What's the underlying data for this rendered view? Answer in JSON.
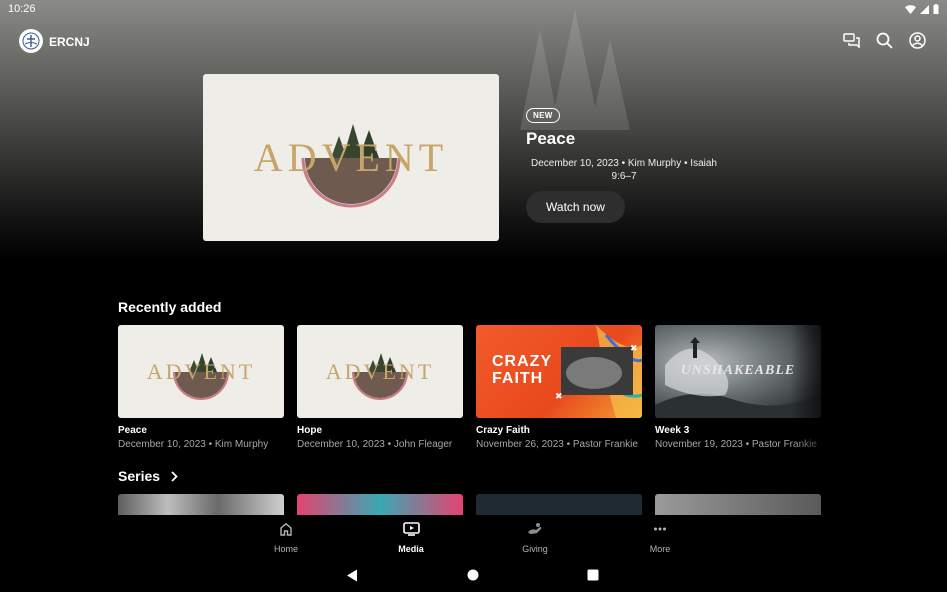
{
  "status": {
    "time": "10:26"
  },
  "app": {
    "brand": "ERCNJ"
  },
  "hero": {
    "thumb_text": "ADVENT",
    "badge": "NEW",
    "title": "Peace",
    "meta": "December 10, 2023 • Kim Murphy • Isaiah 9:6–7",
    "cta": "Watch now"
  },
  "recently_added": {
    "heading": "Recently added",
    "items": [
      {
        "title": "Peace",
        "meta": "December 10, 2023 • Kim Murphy",
        "art_text": "ADVENT"
      },
      {
        "title": "Hope",
        "meta": "December 10, 2023 • John Fleager",
        "art_text": "ADVENT"
      },
      {
        "title": "Crazy Faith",
        "meta": "November 26, 2023 • Pastor Frankie",
        "art_text_1": "CRAZY",
        "art_text_2": "FAITH"
      },
      {
        "title": "Week 3",
        "meta": "November 19, 2023 • Pastor Frankie",
        "art_text": "UNSHAKEABLE"
      }
    ]
  },
  "series": {
    "heading": "Series"
  },
  "bottom_nav": [
    {
      "label": "Home",
      "icon": "home-icon"
    },
    {
      "label": "Media",
      "icon": "tv-play-icon",
      "active": true
    },
    {
      "label": "Giving",
      "icon": "giving-hand-icon"
    },
    {
      "label": "More",
      "icon": "more-dots-icon"
    }
  ],
  "colors": {
    "background": "#000000",
    "button": "#2e2e2e",
    "accent_orange": "#f25a2b",
    "advent_gold": "#c7a56a"
  }
}
